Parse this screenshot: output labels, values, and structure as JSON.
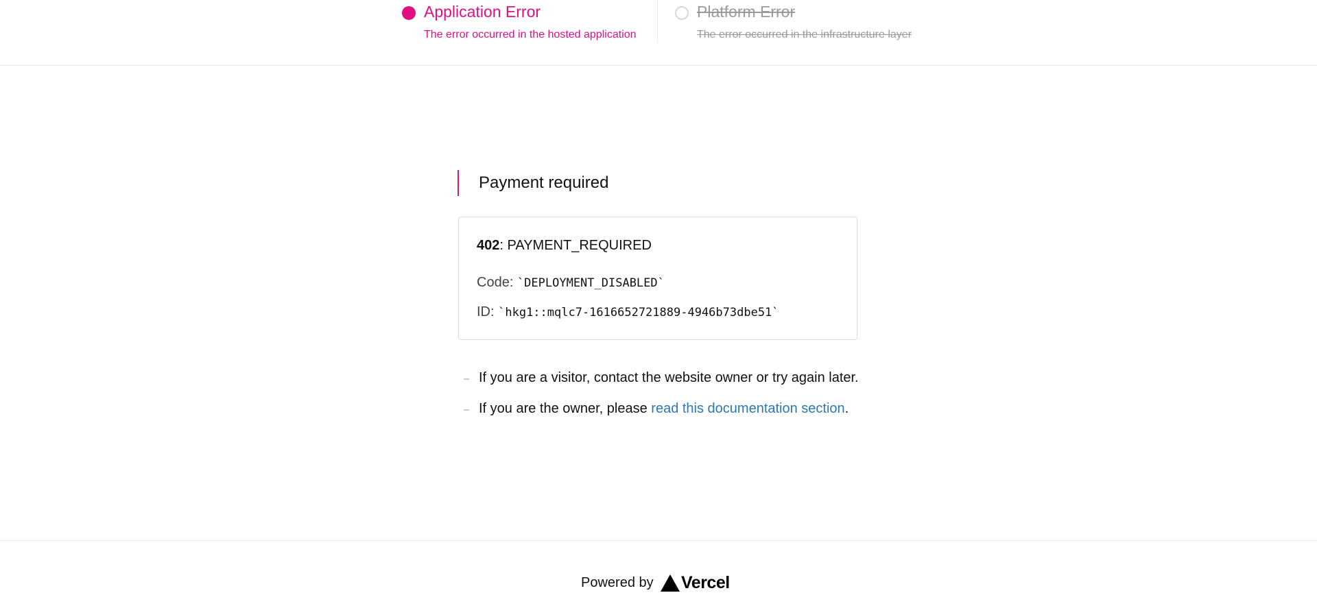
{
  "header": {
    "application_error": {
      "title": "Application Error",
      "subtitle": "The error occurred in the hosted application",
      "state": "selected",
      "color": "#e00f83"
    },
    "platform_error": {
      "title": "Platform Error",
      "subtitle": "The error occurred in the infrastructure layer",
      "state": "struck-through"
    }
  },
  "main": {
    "title": "Payment required",
    "status_code": "402",
    "status_name": ": PAYMENT_REQUIRED",
    "code_label": "Code: ",
    "code_value": "`DEPLOYMENT_DISABLED`",
    "id_label": "ID: ",
    "id_value": "`hkg1::mqlc7-1616652721889-4946b73dbe51`",
    "hints": {
      "visitor": "If you are a visitor, contact the website owner or try again later.",
      "owner_prefix": "If you are the owner, please ",
      "owner_link": "read this documentation section",
      "owner_suffix": ".",
      "dash": "–"
    }
  },
  "footer": {
    "powered_by": "Powered by",
    "brand": "Vercel",
    "logo_icon": "vercel-triangle-icon"
  },
  "colors": {
    "accent": "#e00f83",
    "link": "#2a78b6",
    "muted": "#9a9a9a"
  }
}
